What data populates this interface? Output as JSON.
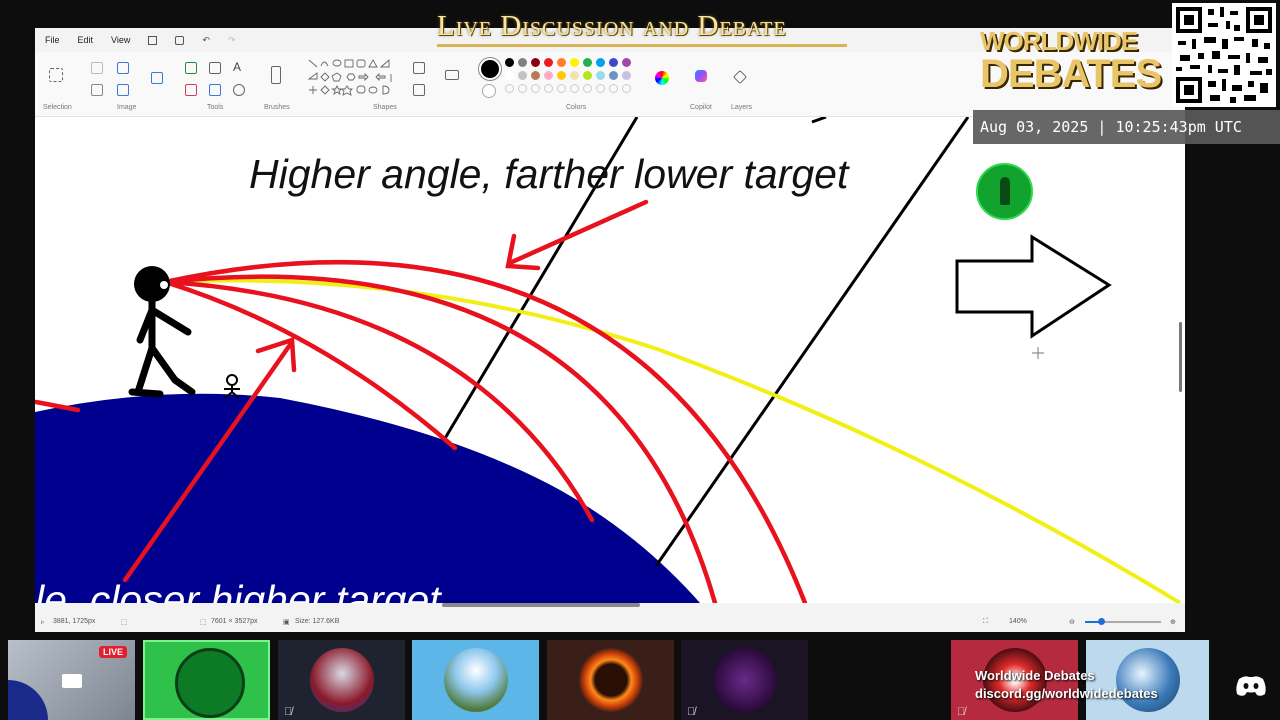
{
  "overlay": {
    "title": "Live Discussion and Debate",
    "logo_line1": "WORLDWIDE",
    "logo_line2": "DEBATES",
    "date_time": "Aug 03, 2025 | 10:25:43pm UTC",
    "discord_name": "Worldwide Debates",
    "discord_link": "discord.gg/worldwidedebates"
  },
  "paint": {
    "menu": [
      "File",
      "Edit",
      "View"
    ],
    "groups": {
      "selection": "Selection",
      "image": "Image",
      "tools": "Tools",
      "brushes": "Brushes",
      "shapes": "Shapes",
      "colors": "Colors",
      "copilot": "Copilot",
      "layers": "Layers"
    },
    "status": {
      "cursor": "3881, 1725px",
      "canvas_size": "7601 × 3527px",
      "file_size": "Size: 127.6KB",
      "zoom": "140%"
    }
  },
  "drawing": {
    "heading_top": "Higher angle, farther lower target",
    "heading_bottom": "le, closer higher target"
  },
  "participants": {
    "live_label": "LIVE"
  },
  "colors": {
    "earth": "#00008f",
    "trajectory": "#e8121e",
    "line_of_sight": "#f2ef14",
    "title_gold": "#f5e6a8",
    "live_red": "#e0202e",
    "green_tile": "#2ec24a"
  },
  "icons": [
    "mic-muted-icon",
    "discord-icon",
    "arrow-right-icon",
    "stick-figure",
    "qr-code"
  ]
}
